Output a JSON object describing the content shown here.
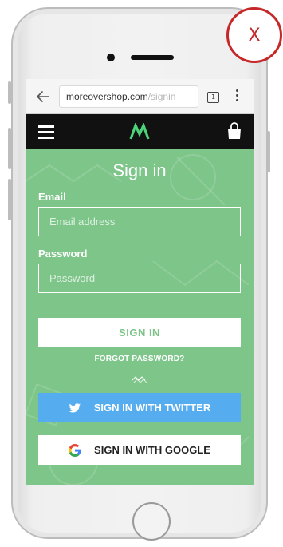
{
  "close_badge": {
    "label": "X",
    "color": "#c62828"
  },
  "browser": {
    "url_host": "moreovershop.com",
    "url_path": "/signin",
    "tab_count": "1",
    "icons": {
      "back": "back-arrow-icon",
      "tabs": "tabs-icon",
      "menu": "more-vert-icon"
    }
  },
  "appbar": {
    "icons": {
      "menu": "hamburger-icon",
      "logo": "brand-logo-icon",
      "cart": "shopping-bag-icon"
    },
    "logo_color": "#4cd37a"
  },
  "signin": {
    "title": "Sign in",
    "email_label": "Email",
    "email_placeholder": "Email address",
    "email_value": "",
    "password_label": "Password",
    "password_placeholder": "Password",
    "password_value": "",
    "submit_label": "SIGN IN",
    "forgot_label": "FORGOT PASSWORD?",
    "twitter_label": "SIGN IN WITH TWITTER",
    "google_label": "SIGN IN WITH GOOGLE"
  },
  "colors": {
    "background_green": "#7ec58a",
    "twitter_blue": "#55acee",
    "appbar_black": "#111111"
  }
}
